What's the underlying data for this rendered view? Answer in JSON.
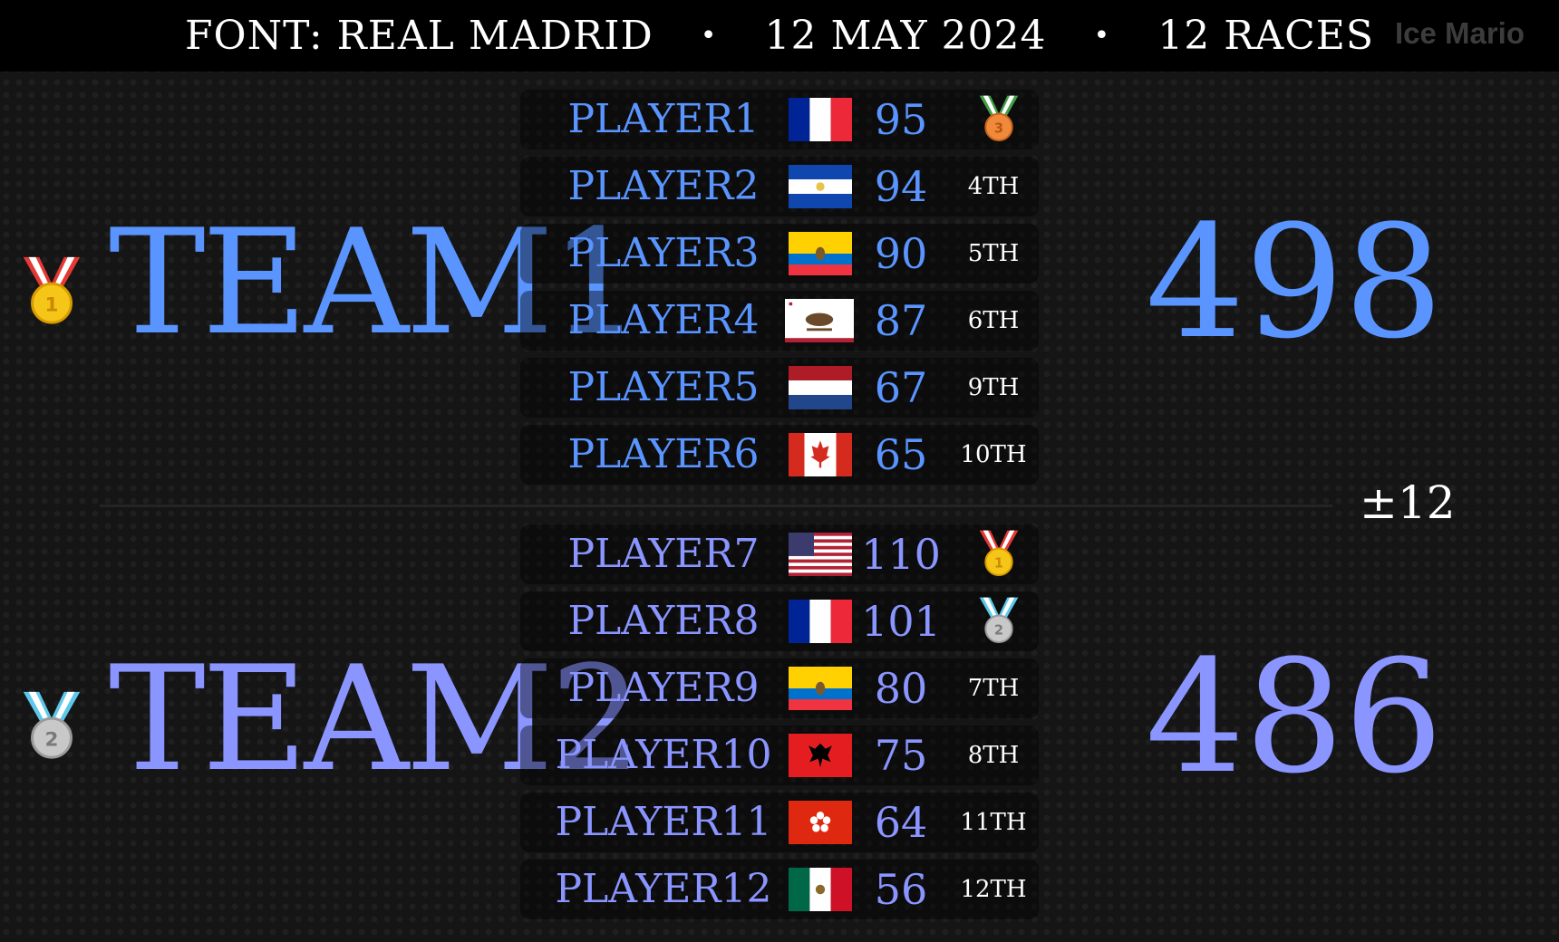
{
  "header": {
    "font_label": "FONT: REAL MADRID",
    "date": "12 MAY 2024",
    "races": "12 RACES",
    "separator": "•",
    "watermark": "Ice Mario"
  },
  "difference": "±12",
  "colors": {
    "team1": "#5a94ff",
    "team2": "#8a95ff",
    "background": "#151515",
    "topbar": "#000000"
  },
  "teams": [
    {
      "name": "TEAM1",
      "score": "498",
      "medal": "gold-medal-icon",
      "rank": "1",
      "players": [
        {
          "name": "PLAYER1",
          "flag": "france-flag-icon",
          "score": "95",
          "place": "",
          "medal": "bronze-medal-icon",
          "medal_number": "3"
        },
        {
          "name": "PLAYER2",
          "flag": "el-salvador-flag-icon",
          "score": "94",
          "place": "4TH"
        },
        {
          "name": "PLAYER3",
          "flag": "ecuador-flag-icon",
          "score": "90",
          "place": "5TH"
        },
        {
          "name": "PLAYER4",
          "flag": "california-flag-icon",
          "score": "87",
          "place": "6TH"
        },
        {
          "name": "PLAYER5",
          "flag": "netherlands-flag-icon",
          "score": "67",
          "place": "9TH"
        },
        {
          "name": "PLAYER6",
          "flag": "canada-flag-icon",
          "score": "65",
          "place": "10TH"
        }
      ]
    },
    {
      "name": "TEAM2",
      "score": "486",
      "medal": "silver-medal-icon",
      "rank": "2",
      "players": [
        {
          "name": "PLAYER7",
          "flag": "usa-flag-icon",
          "score": "110",
          "place": "",
          "medal": "gold-medal-icon",
          "medal_number": "1"
        },
        {
          "name": "PLAYER8",
          "flag": "france-flag-icon",
          "score": "101",
          "place": "",
          "medal": "silver-medal-icon",
          "medal_number": "2"
        },
        {
          "name": "PLAYER9",
          "flag": "ecuador-flag-icon",
          "score": "80",
          "place": "7TH"
        },
        {
          "name": "PLAYER10",
          "flag": "albania-flag-icon",
          "score": "75",
          "place": "8TH"
        },
        {
          "name": "PLAYER11",
          "flag": "hong-kong-flag-icon",
          "score": "64",
          "place": "11TH"
        },
        {
          "name": "PLAYER12",
          "flag": "mexico-flag-icon",
          "score": "56",
          "place": "12TH"
        }
      ]
    }
  ]
}
